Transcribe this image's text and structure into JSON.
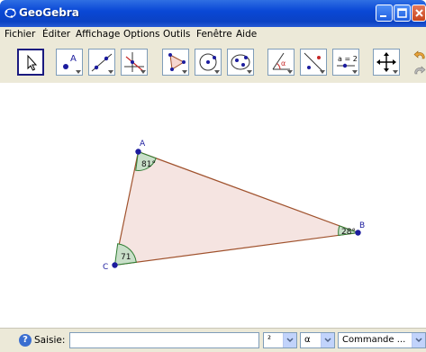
{
  "window": {
    "title": "GeoGebra"
  },
  "menu": [
    "Fichier",
    "Éditer",
    "Affichage",
    "Options",
    "Outils",
    "Fenêtre",
    "Aide"
  ],
  "toolbar": {
    "tools": [
      "move-tool",
      "point-tool",
      "line-tool",
      "perpendicular-line-tool",
      "polygon-tool",
      "circle-center-point-tool",
      "conic-tool",
      "angle-tool",
      "reflect-tool",
      "slider-tool",
      "move-graphics-view-tool"
    ],
    "slider_tool_text": "a = 2"
  },
  "geometry": {
    "points": [
      {
        "name": "A",
        "angle": "81°"
      },
      {
        "name": "B",
        "angle": "28°"
      },
      {
        "name": "C",
        "angle": "71"
      }
    ],
    "colors": {
      "polygon_fill": "#f5e4e1",
      "polygon_stroke": "#a0522d",
      "point": "#1c1c9e",
      "angle_fill": "#c9dfc9",
      "angle_stroke": "#2e7d32"
    }
  },
  "input_bar": {
    "label": "Saisie:",
    "value": "",
    "symbol_combo": "²",
    "greek_combo": "α",
    "command_combo": "Commande ..."
  }
}
